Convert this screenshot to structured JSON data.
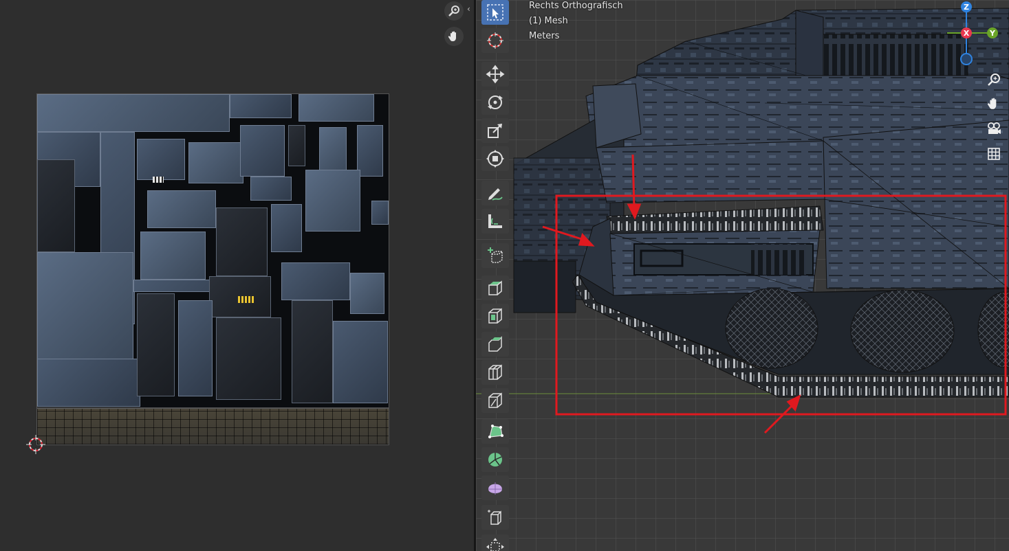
{
  "viewport": {
    "view_name": "Rechts Orthografisch",
    "object_info": "(1) Mesh",
    "units": "Meters"
  },
  "gizmo": {
    "z_label": "Z",
    "x_label": "X",
    "y_label": "Y",
    "colors": {
      "x": "#e8384f",
      "y": "#6aa428",
      "z": "#2f83e0"
    }
  },
  "toolbar": {
    "tools": [
      {
        "name": "select-box-tool",
        "icon": "cursor-box-icon",
        "active": true
      },
      {
        "name": "cursor-tool",
        "icon": "crosshair-icon",
        "active": false
      },
      {
        "name": "move-tool",
        "icon": "move-arrows-icon",
        "active": false
      },
      {
        "name": "rotate-tool",
        "icon": "rotate-icon",
        "active": false
      },
      {
        "name": "scale-tool",
        "icon": "scale-icon",
        "active": false
      },
      {
        "name": "transform-tool",
        "icon": "transform-icon",
        "active": false
      },
      {
        "name": "annotate-tool",
        "icon": "pencil-icon",
        "active": false
      },
      {
        "name": "measure-tool",
        "icon": "ruler-icon",
        "active": false
      },
      {
        "name": "add-cube-tool",
        "icon": "add-cube-icon",
        "active": false
      },
      {
        "name": "extrude-tool",
        "icon": "extrude-icon",
        "active": false
      },
      {
        "name": "inset-tool",
        "icon": "inset-icon",
        "active": false
      },
      {
        "name": "bevel-tool",
        "icon": "bevel-icon",
        "active": false
      },
      {
        "name": "loop-cut-tool",
        "icon": "loop-cut-icon",
        "active": false
      },
      {
        "name": "knife-tool",
        "icon": "knife-icon",
        "active": false
      },
      {
        "name": "poly-build-tool",
        "icon": "poly-build-icon",
        "active": false
      },
      {
        "name": "spin-tool",
        "icon": "spin-icon",
        "active": false
      },
      {
        "name": "smooth-tool",
        "icon": "smooth-icon",
        "active": false
      },
      {
        "name": "shear-tool",
        "icon": "shear-icon",
        "active": false
      },
      {
        "name": "rip-tool",
        "icon": "rip-icon",
        "active": false
      }
    ]
  },
  "accent_colors": {
    "annotation_red": "#e0191f",
    "active_tool": "#4772b3",
    "texel_yellow": "#e9c431"
  }
}
